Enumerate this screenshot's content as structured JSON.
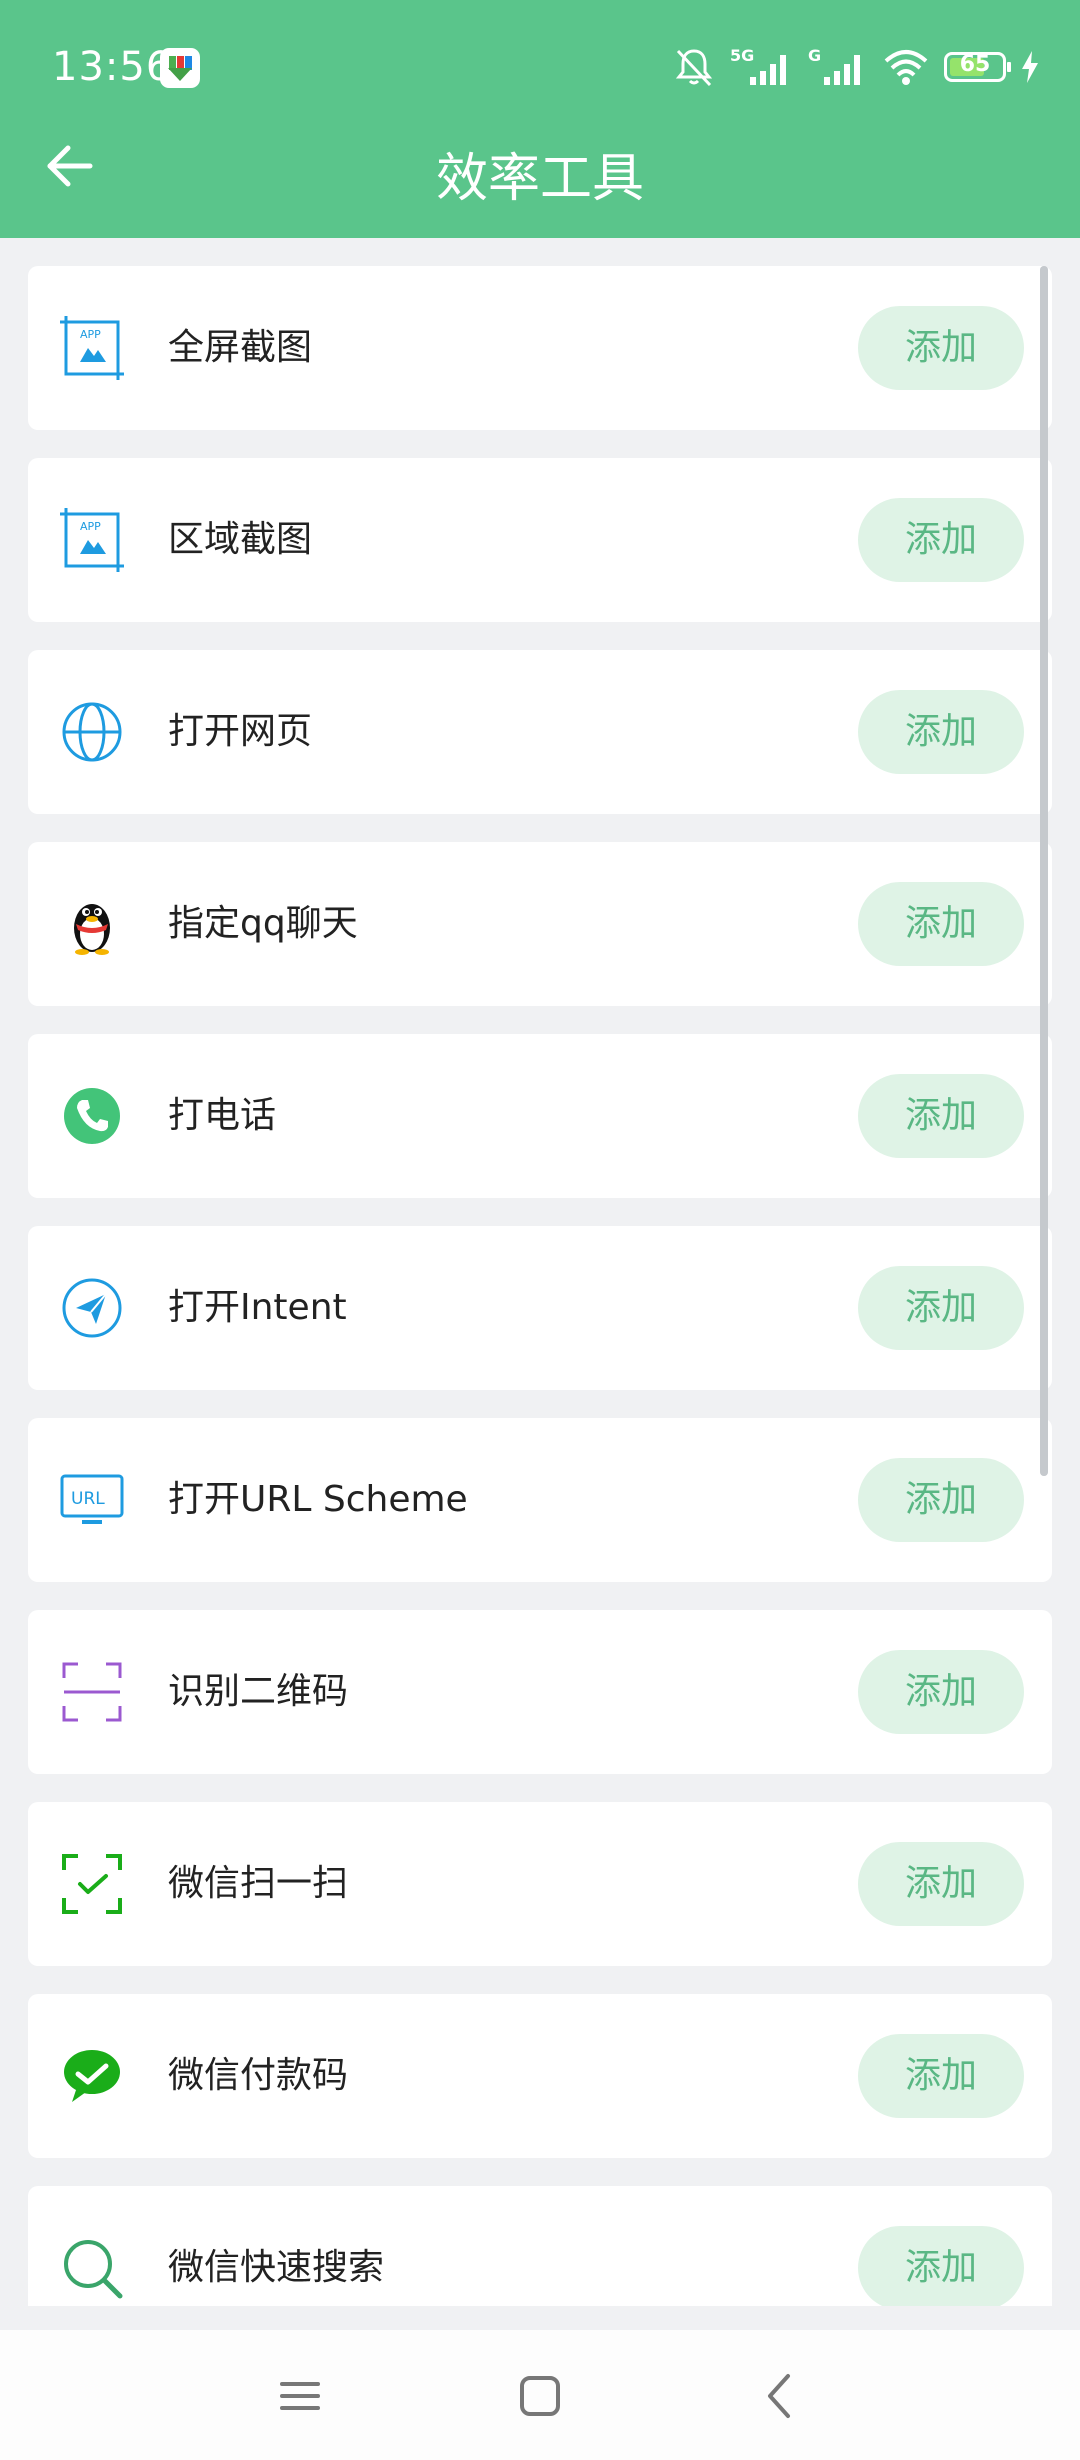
{
  "status_bar": {
    "time": "13:56",
    "signal1_label": "5G",
    "signal2_label": "G",
    "battery_level": "65"
  },
  "header": {
    "title": "效率工具"
  },
  "add_label": "添加",
  "items": [
    {
      "label": "全屏截图",
      "icon": "screenshot-icon"
    },
    {
      "label": "区域截图",
      "icon": "screenshot-icon"
    },
    {
      "label": "打开网页",
      "icon": "globe-icon"
    },
    {
      "label": "指定qq聊天",
      "icon": "qq-penguin-icon"
    },
    {
      "label": "打电话",
      "icon": "phone-icon"
    },
    {
      "label": "打开Intent",
      "icon": "paper-plane-icon"
    },
    {
      "label": "打开URL Scheme",
      "icon": "url-monitor-icon"
    },
    {
      "label": "识别二维码",
      "icon": "scan-frame-icon"
    },
    {
      "label": "微信扫一扫",
      "icon": "wechat-scan-icon"
    },
    {
      "label": "微信付款码",
      "icon": "wechat-pay-icon"
    },
    {
      "label": "微信快速搜索",
      "icon": "search-icon"
    }
  ],
  "colors": {
    "app_bar": "#5ac58b",
    "add_button_bg": "#dff3e6",
    "add_button_text": "#5ab784"
  }
}
